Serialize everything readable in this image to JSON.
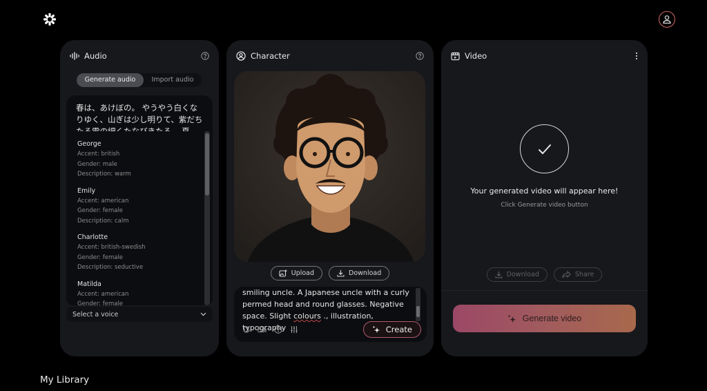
{
  "app": {
    "logo_icon": "flower-logo-icon",
    "profile_icon": "user-avatar-icon"
  },
  "audio": {
    "title": "Audio",
    "tabs": [
      {
        "label": "Generate audio",
        "active": true
      },
      {
        "label": "Import audio",
        "active": false
      }
    ],
    "script_text": "春は、あけぼの。 やうやう白くなりゆく、山ぎは少し明りて、紫だちたる雲の細くたなびきたる。 夏",
    "voices": [
      {
        "name": "George",
        "accent": "Accent: british",
        "gender": "Gender: male",
        "description": "Description: warm"
      },
      {
        "name": "Emily",
        "accent": "Accent: american",
        "gender": "Gender: female",
        "description": "Description: calm"
      },
      {
        "name": "Charlotte",
        "accent": "Accent: british-swedish",
        "gender": "Gender: female",
        "description": "Description: seductive"
      },
      {
        "name": "Matilda",
        "accent": "Accent: american",
        "gender": "Gender: female",
        "description": ""
      }
    ],
    "select_placeholder": "Select a voice"
  },
  "character": {
    "title": "Character",
    "upload_label": "Upload",
    "download_label": "Download",
    "prompt_line1": "smiling uncle. A Japanese uncle with a curly",
    "prompt_line2": "permed head and round glasses. Negative",
    "prompt_line3_pre": "space. Slight ",
    "prompt_line3_spell": "colours",
    "prompt_line3_post": " ., illustration, typography",
    "create_label": "Create"
  },
  "video": {
    "title": "Video",
    "empty_title": "Your generated video will appear here!",
    "empty_subtitle": "Click Generate video button",
    "download_label": "Download",
    "share_label": "Share",
    "generate_label": "Generate video",
    "gradient_start": "#9b4866",
    "gradient_end": "#a8684c"
  },
  "footer": {
    "library_label": "My Library"
  }
}
